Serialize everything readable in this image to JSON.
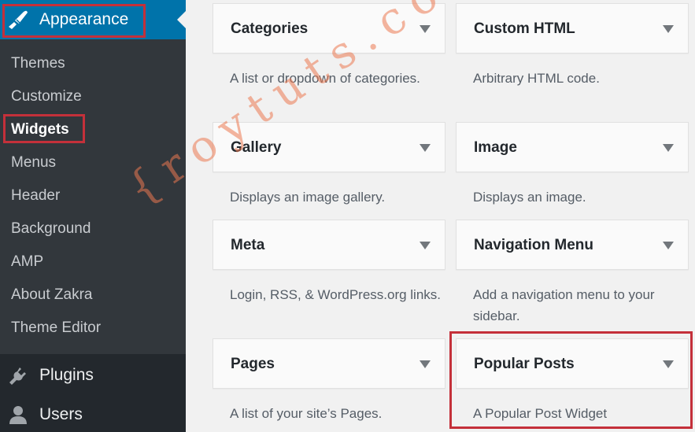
{
  "sidebar": {
    "active_menu": {
      "label": "Appearance",
      "icon": "paintbrush-icon"
    },
    "submenu": [
      {
        "label": "Themes"
      },
      {
        "label": "Customize"
      },
      {
        "label": "Widgets",
        "current": true
      },
      {
        "label": "Menus"
      },
      {
        "label": "Header"
      },
      {
        "label": "Background"
      },
      {
        "label": "AMP"
      },
      {
        "label": "About Zakra"
      },
      {
        "label": "Theme Editor"
      }
    ],
    "bottom_menu": [
      {
        "label": "Plugins",
        "icon": "plug-icon"
      },
      {
        "label": "Users",
        "icon": "user-icon"
      }
    ]
  },
  "widgets": [
    {
      "title": "Categories",
      "description": "A list or dropdown of categories."
    },
    {
      "title": "Custom HTML",
      "description": "Arbitrary HTML code."
    },
    {
      "title": "Gallery",
      "description": "Displays an image gallery."
    },
    {
      "title": "Image",
      "description": "Displays an image."
    },
    {
      "title": "Meta",
      "description": "Login, RSS, & WordPress.org links."
    },
    {
      "title": "Navigation Menu",
      "description": "Add a navigation menu to your sidebar."
    },
    {
      "title": "Pages",
      "description": "A list of your site’s Pages."
    },
    {
      "title": "Popular Posts",
      "description": "A Popular Post Widget",
      "highlighted": true
    }
  ],
  "watermark": "{roytuts.com}",
  "colors": {
    "sidebar_bg": "#32373c",
    "active_menu_bg": "#0073aa",
    "highlight_border": "#c4303a"
  }
}
